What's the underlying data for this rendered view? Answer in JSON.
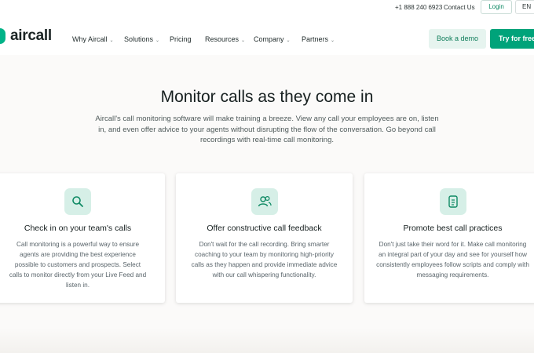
{
  "topbar": {
    "phone": "+1 888 240 6923",
    "contact": "Contact Us",
    "login": "Login",
    "lang": "EN"
  },
  "brand": {
    "name": "aircall",
    "accent": "#00b388"
  },
  "nav": {
    "items": [
      {
        "label": "Why Aircall",
        "dropdown": true
      },
      {
        "label": "Solutions",
        "dropdown": true
      },
      {
        "label": "Pricing",
        "dropdown": false
      },
      {
        "label": "Resources",
        "dropdown": true
      },
      {
        "label": "Company",
        "dropdown": true
      },
      {
        "label": "Partners",
        "dropdown": true
      }
    ],
    "demo_label": "Book a demo",
    "try_label": "Try for free"
  },
  "hero": {
    "title": "Monitor calls as they come in",
    "subtitle": "Aircall's call monitoring software will make training a breeze. View any call your employees are on, listen in, and even offer advice to your agents without disrupting the flow of the conversation. Go beyond call recordings with real-time call monitoring."
  },
  "cards": [
    {
      "icon": "search-icon",
      "title": "Check in on your team's calls",
      "body": "Call monitoring is a powerful way to ensure agents are providing the best experience possible to customers and prospects. Select calls to monitor directly from your Live Feed and listen in."
    },
    {
      "icon": "users-icon",
      "title": "Offer constructive call feedback",
      "body": "Don't wait for the call recording. Bring smarter coaching to your team by monitoring high-priority calls as they happen and provide immediate advice with our call whispering functionality."
    },
    {
      "icon": "document-icon",
      "title": "Promote best call practices",
      "body": "Don't just take their word for it. Make call monitoring an integral part of your day and see for yourself how consistently employees follow scripts and comply with messaging requirements."
    }
  ]
}
